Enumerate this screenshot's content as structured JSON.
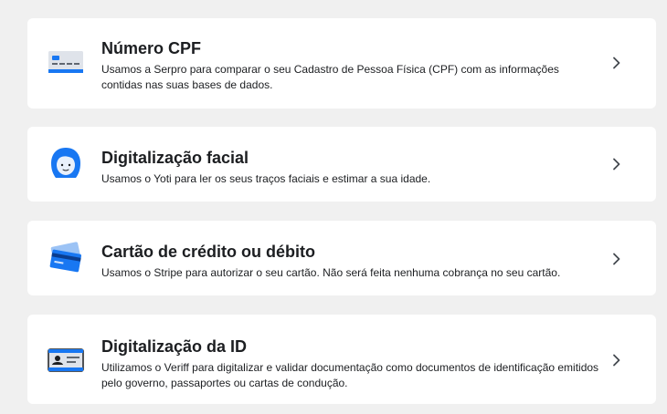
{
  "options": [
    {
      "title": "Número CPF",
      "description": "Usamos a Serpro para comparar o seu Cadastro de Pessoa Física (CPF) com as informações contidas nas suas bases de dados.",
      "icon": "cpf-card-icon"
    },
    {
      "title": "Digitalização facial",
      "description": "Usamos o Yoti para ler os seus traços faciais e estimar a sua idade.",
      "icon": "face-scan-icon"
    },
    {
      "title": "Cartão de crédito ou débito",
      "description": "Usamos o Stripe para autorizar o seu cartão. Não será feita nenhuma cobrança no seu cartão.",
      "icon": "credit-card-icon"
    },
    {
      "title": "Digitalização da ID",
      "description": "Utilizamos o Veriff para digitalizar e validar documentação como documentos de identificação emitidos pelo governo, passaportes ou cartas de condução.",
      "icon": "id-card-icon"
    }
  ],
  "colors": {
    "background": "#f0f0f0",
    "card": "#ffffff",
    "accent_blue": "#1877f2",
    "text": "#1c1e21"
  }
}
